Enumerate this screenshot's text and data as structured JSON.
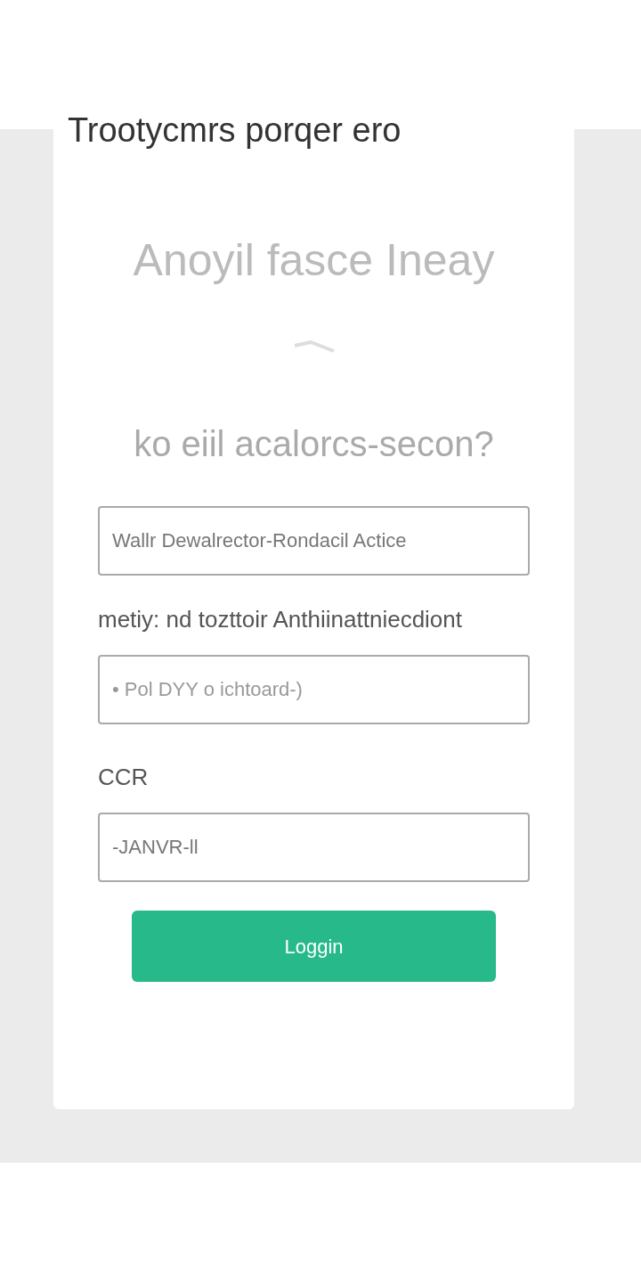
{
  "title": "Trootycmrs porqer ero",
  "heading": "Anoyil fasce Ineay",
  "subheading": "ko eiil acalorcs-secon?",
  "fields": [
    {
      "kind": "value",
      "text": "Wallr Dewalrector-Rondacil Actice"
    },
    {
      "kind": "label",
      "text": "metiy: nd tozttoir Anthiinattniecdiont"
    },
    {
      "kind": "placeholder",
      "placeholder": "• Pol DYY o ichtoard-)"
    },
    {
      "kind": "label",
      "text": "CCR"
    },
    {
      "kind": "value",
      "text": "-JANVR-ll"
    }
  ],
  "button": "Loggin"
}
